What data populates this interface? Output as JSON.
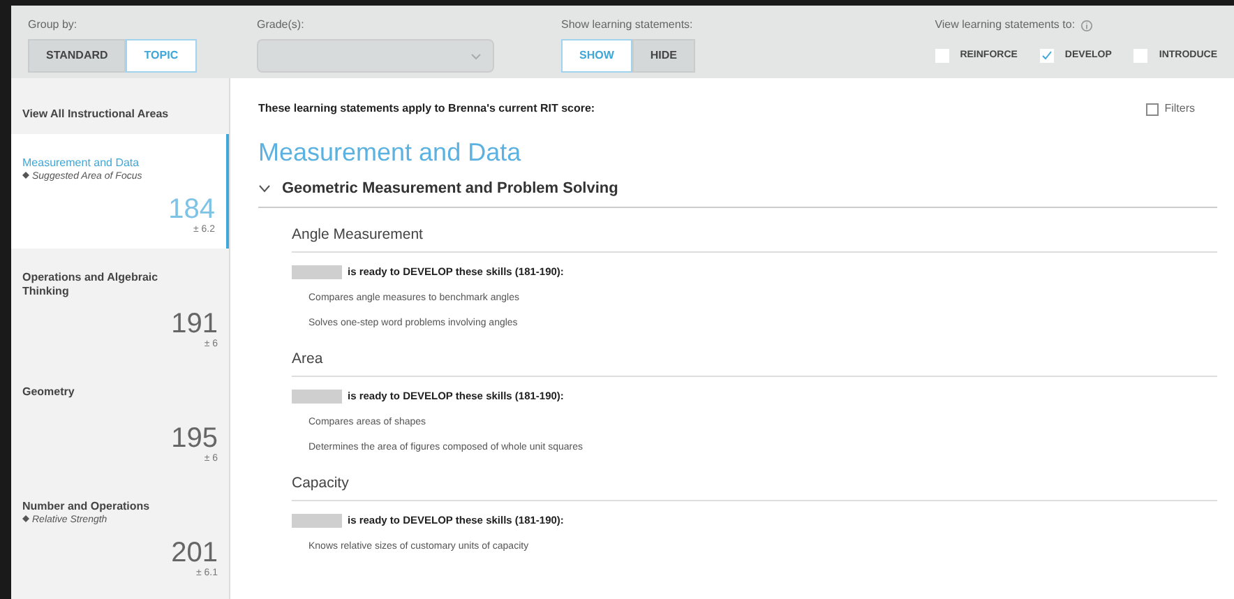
{
  "toolbar": {
    "group_by": {
      "label": "Group by:",
      "options": [
        {
          "label": "STANDARD",
          "selected": false
        },
        {
          "label": "TOPIC",
          "selected": true
        }
      ]
    },
    "grade": {
      "label": "Grade(s):",
      "disabled": true
    },
    "show_statements": {
      "label": "Show learning statements:",
      "options": [
        {
          "label": "SHOW",
          "selected": true
        },
        {
          "label": "HIDE",
          "selected": false
        }
      ]
    },
    "view_statements": {
      "label": "View learning statements to:",
      "options": [
        {
          "label": "REINFORCE",
          "checked": false
        },
        {
          "label": "DEVELOP",
          "checked": true
        },
        {
          "label": "INTRODUCE",
          "checked": false
        }
      ]
    }
  },
  "sidebar": {
    "header": "View All Instructional Areas",
    "items": [
      {
        "name": "Measurement and Data",
        "note": "Suggested Area of Focus",
        "score": "184",
        "error": "± 6.2",
        "selected": true
      },
      {
        "name": "Operations and Algebraic Thinking",
        "score": "191",
        "error": "± 6",
        "selected": false
      },
      {
        "name": "Geometry",
        "score": "195",
        "error": "± 6",
        "selected": false
      },
      {
        "name": "Number and Operations",
        "note": "Relative Strength",
        "score": "201",
        "error": "± 6.1",
        "selected": false
      }
    ]
  },
  "main": {
    "intro": "These learning statements apply to Brenna's current RIT score:",
    "filters": "Filters",
    "title": "Measurement and Data",
    "section": {
      "title": "Geometric Measurement and Problem Solving",
      "expanded": true,
      "topics": [
        {
          "title": "Angle Measurement",
          "heading": "is ready to DEVELOP these skills (181-190):",
          "skills": [
            "Compares angle measures to benchmark angles",
            "Solves one-step word problems involving angles"
          ]
        },
        {
          "title": "Area",
          "heading": "is ready to DEVELOP these skills (181-190):",
          "skills": [
            "Compares areas of shapes",
            "Determines the area of figures composed of whole unit squares"
          ]
        },
        {
          "title": "Capacity",
          "heading": "is ready to DEVELOP these skills (181-190):",
          "skills": [
            "Knows relative sizes of customary units of capacity"
          ]
        }
      ]
    }
  }
}
